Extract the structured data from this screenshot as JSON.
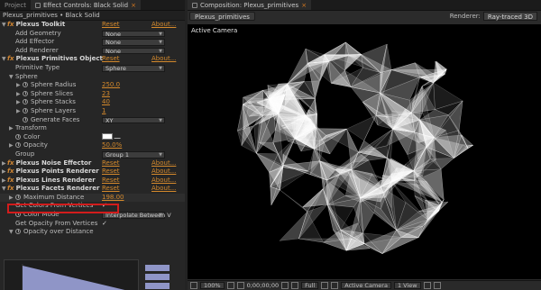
{
  "tabs_left": [
    {
      "label": "Project"
    },
    {
      "label": "Effect Controls: Black Solid",
      "close": "×"
    }
  ],
  "tabs_right": {
    "label": "Composition: Plexus_primitives",
    "close": "×"
  },
  "breadcrumb": "Plexus_primitives • Black Solid",
  "effects": {
    "toolkit": {
      "name": "Plexus Toolkit",
      "reset": "Reset",
      "about": "About...",
      "add_geometry": {
        "label": "Add Geometry",
        "value": "None"
      },
      "add_effector": {
        "label": "Add Effector",
        "value": "None"
      },
      "add_renderer": {
        "label": "Add Renderer",
        "value": "None"
      }
    },
    "primitives": {
      "name": "Plexus Primitives Object",
      "reset": "Reset",
      "about": "About...",
      "primitive_type": {
        "label": "Primitive Type",
        "value": "Sphere"
      },
      "sphere_group": "Sphere",
      "sphere_radius": {
        "label": "Sphere Radius",
        "value": "250.0"
      },
      "sphere_slices": {
        "label": "Sphere Slices",
        "value": "23"
      },
      "sphere_stacks": {
        "label": "Sphere Stacks",
        "value": "40"
      },
      "sphere_layers": {
        "label": "Sphere Layers",
        "value": "1"
      },
      "generate_faces": {
        "label": "Generate Faces",
        "value": "XY"
      },
      "transform": "Transform",
      "color": {
        "label": "Color"
      },
      "opacity": {
        "label": "Opacity",
        "value": "50.0%"
      },
      "group": {
        "label": "Group",
        "value": "Group 1"
      }
    },
    "noise": {
      "name": "Plexus Noise Effector",
      "reset": "Reset",
      "about": "About..."
    },
    "points": {
      "name": "Plexus Points Renderer",
      "reset": "Reset",
      "about": "About..."
    },
    "lines": {
      "name": "Plexus Lines Renderer",
      "reset": "Reset",
      "about": "About..."
    },
    "facets": {
      "name": "Plexus Facets Renderer",
      "reset": "Reset",
      "about": "About...",
      "max_distance": {
        "label": "Maximum Distance",
        "value": "198.00"
      },
      "colors_from_vertices": {
        "label": "Get Colors From Vertices",
        "checked": "✓"
      },
      "color_mode": {
        "label": "Color Mode",
        "value": "Interpolate Between V"
      },
      "opacity_from_vertices": {
        "label": "Get Opacity From Vertices",
        "checked": "✓"
      },
      "opacity_over_distance": {
        "label": "Opacity over Distance"
      }
    }
  },
  "graph": {
    "type": "area",
    "start": 1.0,
    "end": 0.0
  },
  "composition": {
    "tab": "Plexus_primitives",
    "renderer_label": "Renderer:",
    "renderer_value": "Ray-traced 3D",
    "camera_label": "Active Camera"
  },
  "statusbar": {
    "zoom": "100%",
    "timecode": "0;00;00;00",
    "resolution": "Full",
    "camera": "Active Camera",
    "views": "1 View"
  },
  "colors": {
    "accent": "#d4892c",
    "highlight_box": "#d21c1c",
    "graph_fill": "#8f95c7"
  }
}
